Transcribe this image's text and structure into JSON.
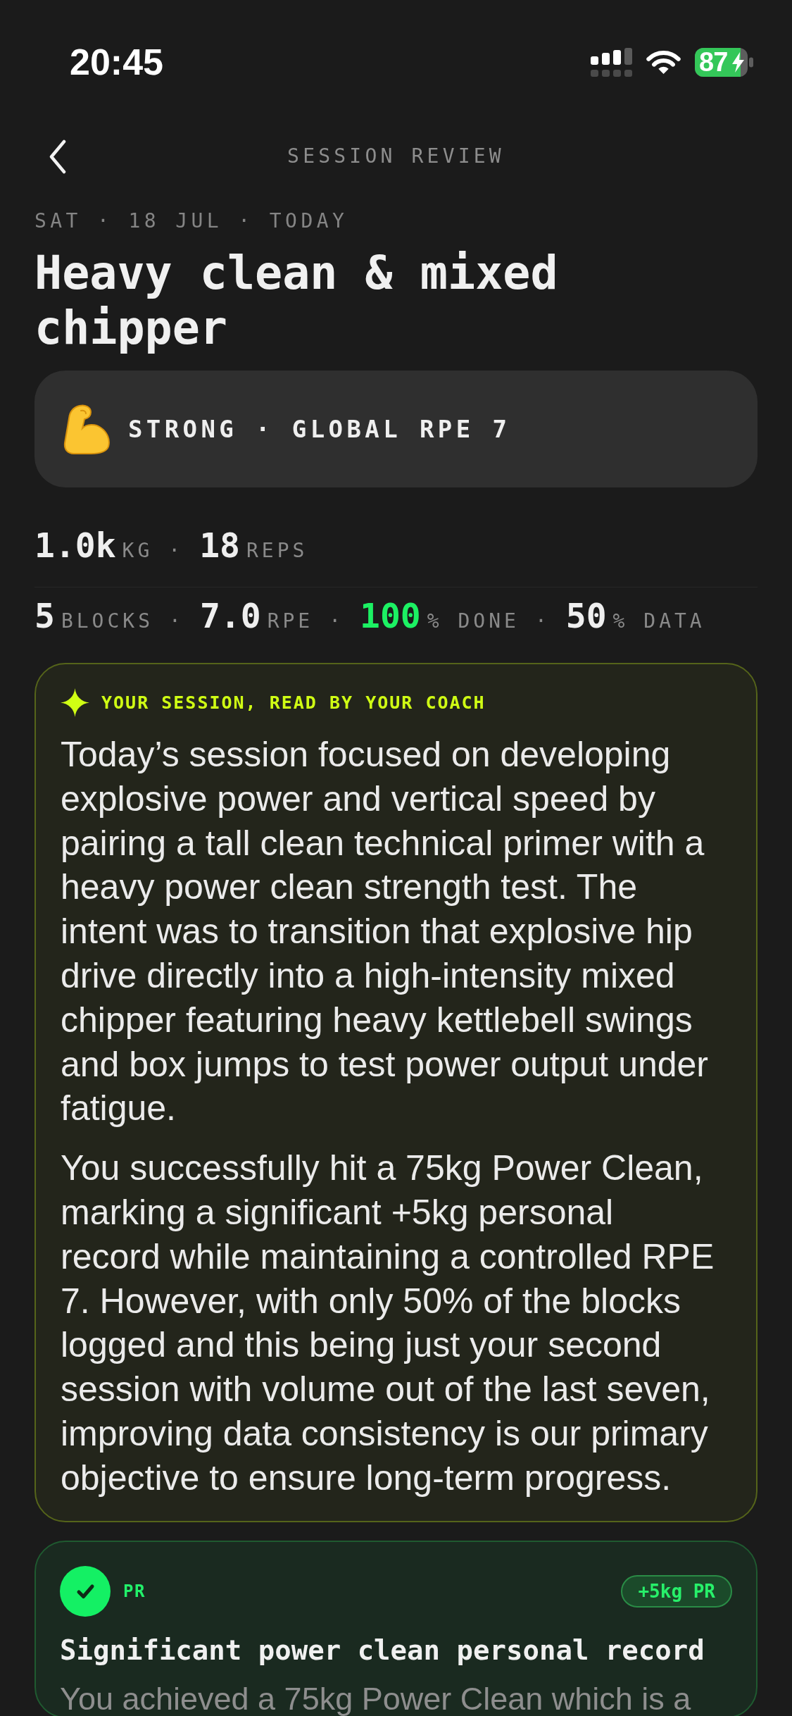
{
  "status_bar": {
    "time": "20:45",
    "battery": "87"
  },
  "header": {
    "title": "SESSION REVIEW"
  },
  "session": {
    "date": "SAT · 18 JUL · TODAY",
    "title": "Heavy clean & mixed chipper",
    "feel": "STRONG · GLOBAL RPE 7"
  },
  "stats": [
    {
      "items": [
        {
          "value": "1.0k",
          "unit": "KG",
          "highlighted": false
        },
        {
          "separator": "·",
          "value": "18",
          "unit": "REPS",
          "highlighted": false
        }
      ]
    },
    {
      "items": [
        {
          "value": "5",
          "unit": "BLOCKS",
          "highlighted": false
        },
        {
          "separator": "·",
          "value": "7.0",
          "unit": "RPE",
          "highlighted": false
        },
        {
          "separator": "·",
          "value": "100",
          "unit": "% DONE",
          "highlighted": true
        },
        {
          "separator": "·",
          "value": "50",
          "unit": "% DATA",
          "highlighted": false
        }
      ]
    }
  ],
  "coach": {
    "label": "YOUR SESSION, READ BY YOUR COACH",
    "paragraphs": [
      "Today’s session focused on developing explosive power and vertical speed by pairing a tall clean technical primer with a heavy power clean strength test. The intent was to transition that explosive hip drive directly into a high-intensity mixed chipper featuring heavy kettlebell swings and box jumps to test power output under fatigue.",
      "You successfully hit a 75kg Power Clean, marking a significant +5kg personal record while maintaining a controlled RPE 7. However, with only 50% of the blocks logged and this being just your second session with volume out of the last seven, improving data consistency is our primary objective to ensure long-term progress."
    ]
  },
  "insights": [
    {
      "kind": "pr",
      "tag": "PR",
      "badge": "+5kg PR",
      "title": "Significant power clean personal record",
      "body": "You achieved a 75kg Power Clean which is a"
    }
  ]
}
